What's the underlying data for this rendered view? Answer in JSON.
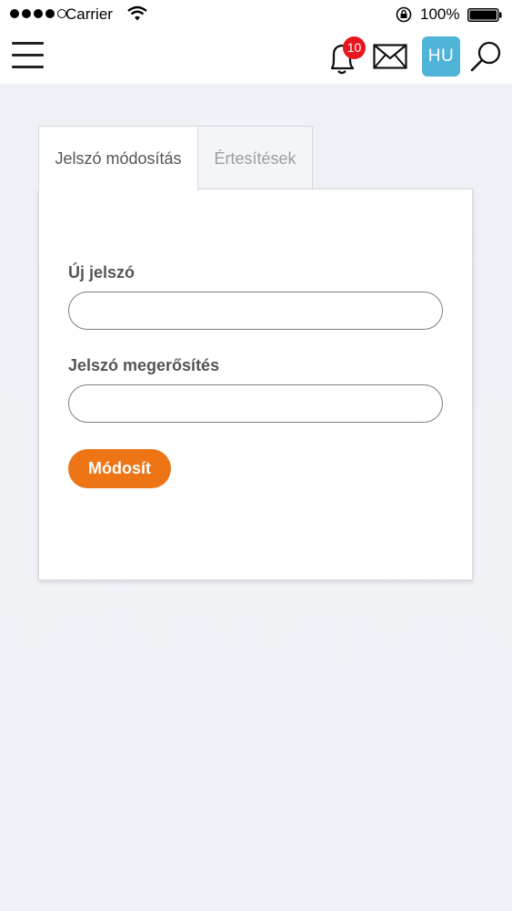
{
  "status_bar": {
    "carrier": "Carrier",
    "battery_percent": "100%",
    "signal_bars": 4
  },
  "header": {
    "menu_icon": "hamburger-icon",
    "notifications_icon": "bell-icon",
    "notification_count": "10",
    "messages_icon": "envelope-icon",
    "language": "HU",
    "search_icon": "search-icon",
    "colors": {
      "badge": "#e8161d",
      "language": "#4fb4d8"
    }
  },
  "tabs": [
    {
      "label": "Jelszó módosítás",
      "active": true
    },
    {
      "label": "Értesítések",
      "active": false
    }
  ],
  "form": {
    "new_password_label": "Új jelszó",
    "new_password_value": "",
    "confirm_label": "Jelszó megerősítés",
    "confirm_value": "",
    "submit_label": "Módosít",
    "accent_color": "#ed7516"
  }
}
